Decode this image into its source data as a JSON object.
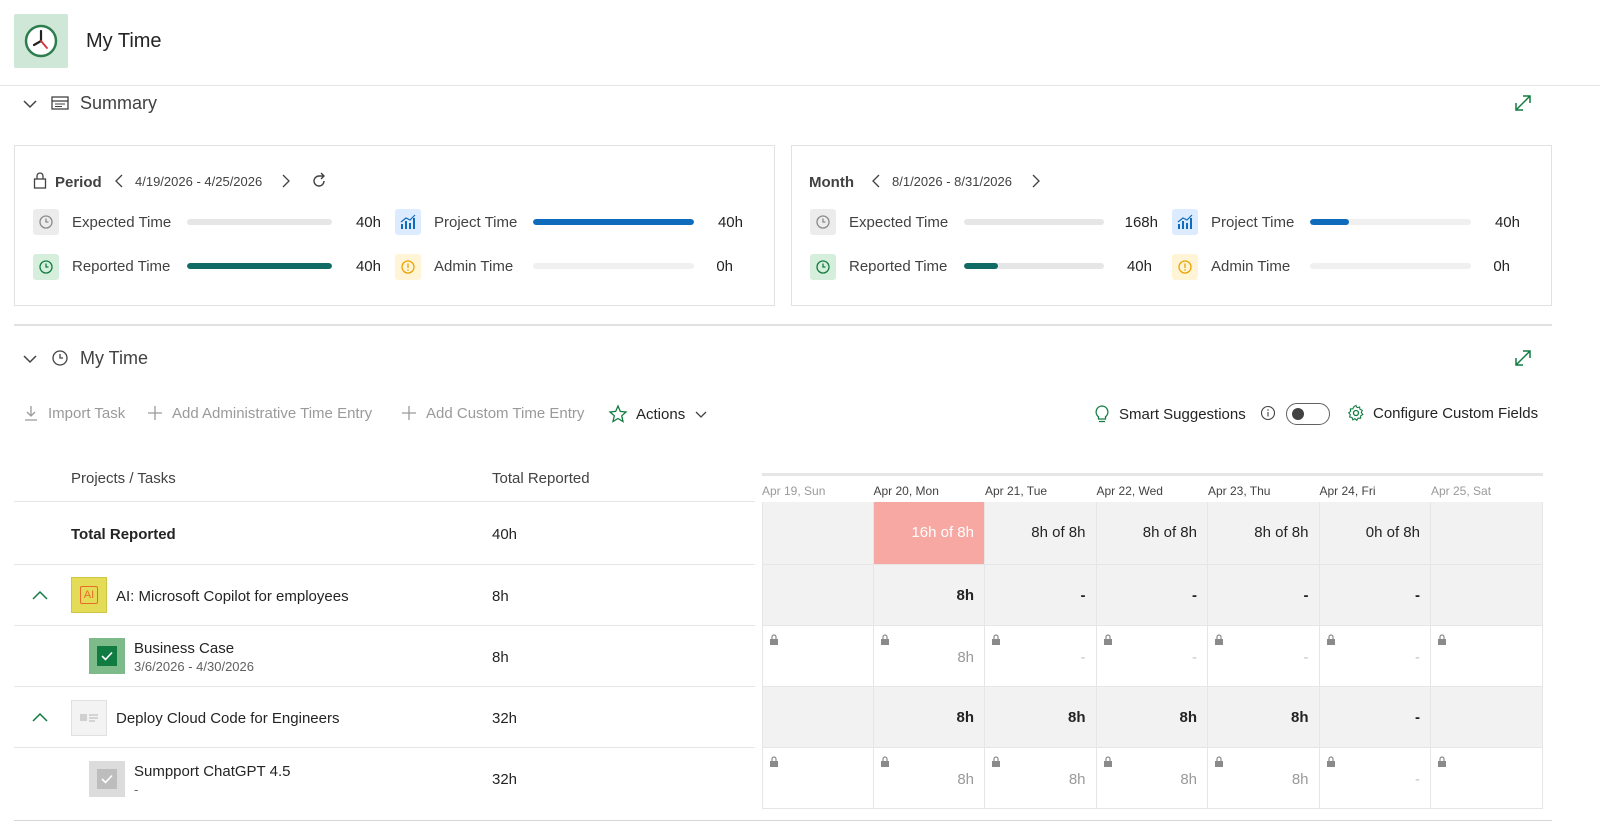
{
  "app": {
    "title": "My Time"
  },
  "summary": {
    "title": "Summary",
    "period": {
      "label": "Period",
      "range": "4/19/2026 - 4/25/2026",
      "expected": {
        "label": "Expected Time",
        "value": "40h",
        "fill": 0.0
      },
      "reported": {
        "label": "Reported Time",
        "value": "40h",
        "fill": 1.0
      },
      "project": {
        "label": "Project Time",
        "value": "40h",
        "fill": 1.0
      },
      "admin": {
        "label": "Admin Time",
        "value": "0h",
        "fill": 0.0
      }
    },
    "month": {
      "label": "Month",
      "range": "8/1/2026 - 8/31/2026",
      "expected": {
        "label": "Expected Time",
        "value": "168h",
        "fill": 0.0
      },
      "reported": {
        "label": "Reported Time",
        "value": "40h",
        "fill": 0.24
      },
      "project": {
        "label": "Project Time",
        "value": "40h",
        "fill": 0.24
      },
      "admin": {
        "label": "Admin Time",
        "value": "0h",
        "fill": 0.0
      }
    }
  },
  "mytime": {
    "title": "My Time",
    "toolbar": {
      "import": "Import Task",
      "add_admin": "Add Administrative Time Entry",
      "add_custom": "Add Custom Time Entry",
      "actions": "Actions",
      "smart": "Smart Suggestions",
      "configure": "Configure Custom Fields"
    },
    "columns": {
      "tasks": "Projects / Tasks",
      "total": "Total Reported"
    },
    "days": [
      "Apr 19, Sun",
      "Apr 20, Mon",
      "Apr 21, Tue",
      "Apr 22, Wed",
      "Apr 23, Thu",
      "Apr 24, Fri",
      "Apr 25, Sat"
    ],
    "total_row": {
      "label": "Total Reported",
      "total": "40h",
      "cells": [
        "",
        "16h of 8h",
        "8h of 8h",
        "8h of 8h",
        "8h of 8h",
        "0h of 8h",
        ""
      ]
    },
    "rows": [
      {
        "label": "AI: Microsoft Copilot for employees",
        "total": "8h",
        "cells": [
          "",
          "8h",
          "-",
          "-",
          "-",
          "-",
          ""
        ],
        "icon_text": "AI"
      },
      {
        "label": "Business Case",
        "sub": "3/6/2026 - 4/30/2026",
        "total": "8h",
        "cells": [
          "",
          "8h",
          "-",
          "-",
          "-",
          "-",
          ""
        ]
      },
      {
        "label": "Deploy Cloud Code for Engineers",
        "total": "32h",
        "cells": [
          "",
          "8h",
          "8h",
          "8h",
          "8h",
          "-",
          ""
        ]
      },
      {
        "label": "Sumpport ChatGPT 4.5",
        "sub": "-",
        "total": "32h",
        "cells": [
          "",
          "8h",
          "8h",
          "8h",
          "8h",
          "-",
          ""
        ]
      }
    ]
  },
  "colors": {
    "accent_green": "#107c41",
    "teal": "#0f6b63",
    "blue": "#0f6cbd",
    "over": "#f7a8a3"
  }
}
